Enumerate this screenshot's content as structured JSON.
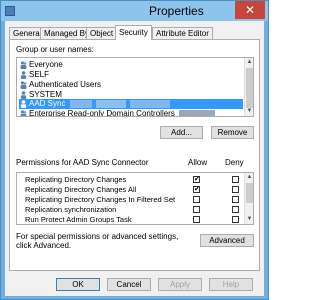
{
  "window": {
    "title": "Properties",
    "close_glyph": "✕"
  },
  "tabs": [
    {
      "label": "General"
    },
    {
      "label": "Managed By"
    },
    {
      "label": "Object"
    },
    {
      "label": "Security",
      "active": true
    },
    {
      "label": "Attribute Editor"
    }
  ],
  "group_label": "Group or user names:",
  "users": [
    {
      "name": "Everyone",
      "icon": "group-icon",
      "redacted": false
    },
    {
      "name": "SELF",
      "icon": "user-icon",
      "redacted": false
    },
    {
      "name": "Authenticated Users",
      "icon": "group-icon",
      "redacted": false
    },
    {
      "name": "SYSTEM",
      "icon": "user-icon",
      "redacted": false
    },
    {
      "name": "AAD Sync",
      "icon": "user-icon",
      "redacted": true,
      "selected": true
    },
    {
      "name": "Enterprise Read-only Domain Controllers",
      "icon": "group-icon",
      "redacted": true
    }
  ],
  "buttons": {
    "add": "Add...",
    "remove": "Remove",
    "advanced": "Advanced",
    "ok": "OK",
    "cancel": "Cancel",
    "apply": "Apply",
    "help": "Help"
  },
  "permissions": {
    "header": "Permissions for AAD Sync Connector",
    "allow_label": "Allow",
    "deny_label": "Deny",
    "rows": [
      {
        "name": "Replicating Directory Changes",
        "allow": true,
        "deny": false
      },
      {
        "name": "Replicating Directory Changes All",
        "allow": true,
        "deny": false
      },
      {
        "name": "Replicating Directory Changes In Filtered Set",
        "allow": false,
        "deny": false
      },
      {
        "name": "Replication synchronization",
        "allow": false,
        "deny": false
      },
      {
        "name": "Run Protect Admin Groups Task",
        "allow": false,
        "deny": false
      }
    ]
  },
  "special_note": "For special permissions or advanced settings, click Advanced.",
  "check_glyph": "✔",
  "colors": {
    "selection": "#3399ff",
    "titlebar": "#8cc4ec",
    "close": "#c7453b"
  }
}
